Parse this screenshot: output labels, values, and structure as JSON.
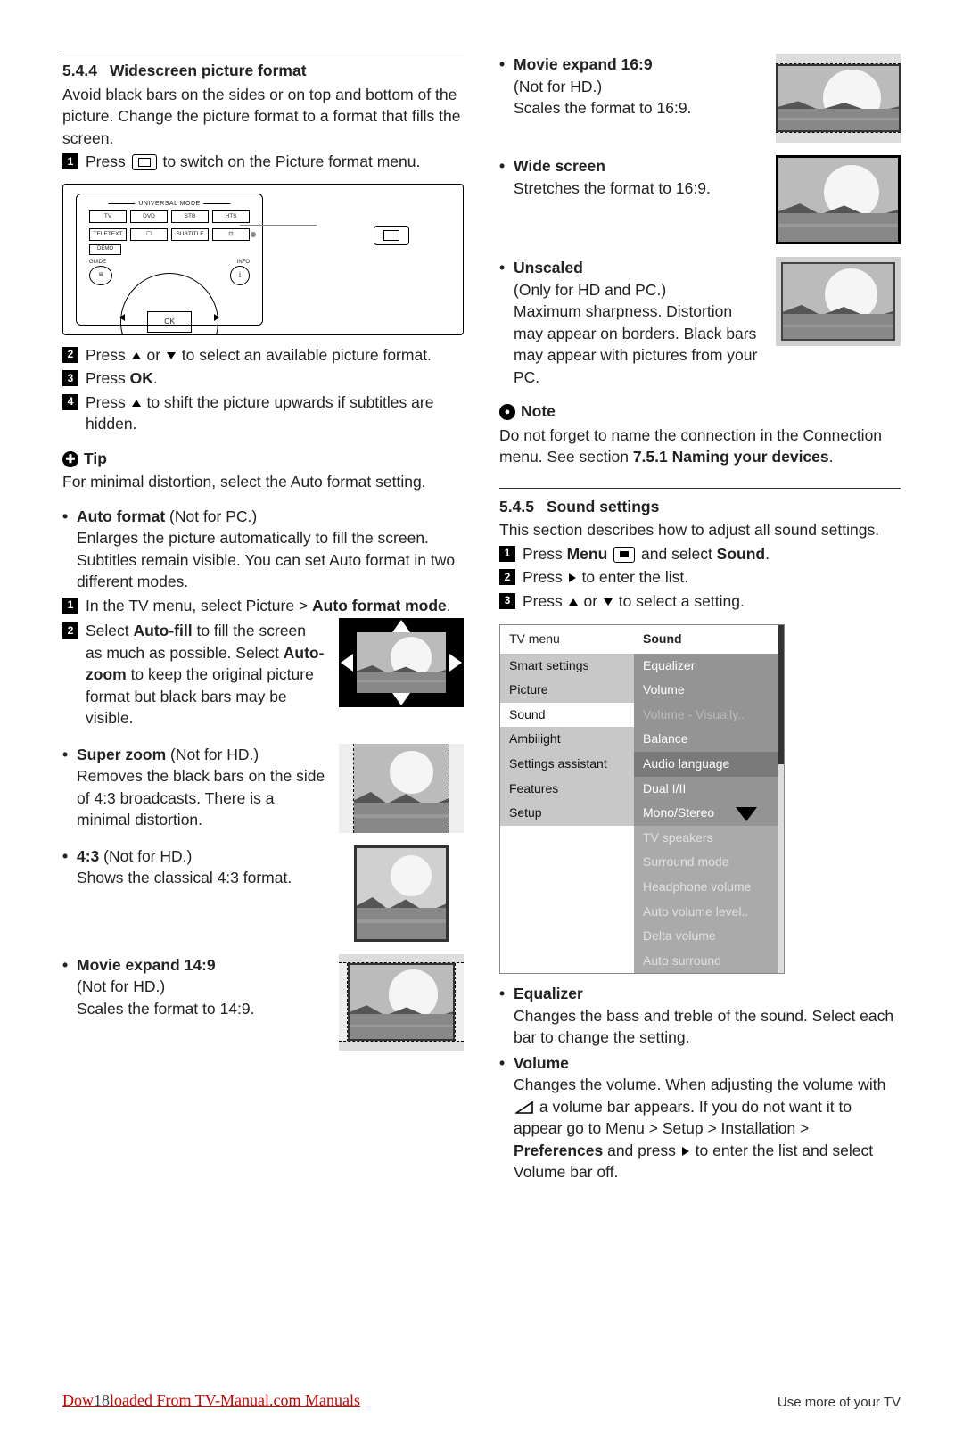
{
  "left": {
    "sec544": {
      "num": "5.4.4",
      "title": "Widescreen picture format",
      "intro": "Avoid black bars on the sides or on top and bottom of the picture. Change the picture format to a format that fills the screen.",
      "step1a": "Press ",
      "step1b": " to switch on the Picture format menu.",
      "step2": "Press ",
      "step2b": " or ",
      "step2c": " to select an available picture format.",
      "step3a": "Press ",
      "step3b": "OK",
      "step3c": ".",
      "step4": "Press ",
      "step4b": " to shift the picture upwards if subtitles are hidden."
    },
    "remote": {
      "mode": "UNIVERSAL MODE",
      "tv": "TV",
      "dvd": "DVD",
      "stb": "STB",
      "hts": "HTS",
      "teletext": "TELETEXT",
      "subtitle": "SUBTITLE",
      "demo": "DEMO",
      "guide": "GUIDE",
      "info": "INFO",
      "ok": "OK"
    },
    "tip": {
      "label": "Tip",
      "text": "For minimal distortion, select the Auto format setting."
    },
    "autoformat": {
      "head": "Auto format",
      "note": " (Not for PC.)",
      "body": "Enlarges the picture automatically to fill the screen. Subtitles remain visible. You can set Auto format in two different modes.",
      "s1a": "In the TV menu, select Picture > ",
      "s1b": "Auto format mode",
      "s1c": ".",
      "s2a": "Select ",
      "s2b": "Auto-fill",
      "s2c": " to fill the screen as much as possible. Select ",
      "s2d": "Auto-zoom",
      "s2e": " to keep the original picture format but black bars may be visible."
    },
    "superzoom": {
      "head": "Super zoom",
      "note": " (Not for HD.)",
      "body": "Removes the black bars on the side of 4:3 broadcasts. There is a minimal distortion."
    },
    "f43": {
      "head": "4:3",
      "note": " (Not for HD.)",
      "body": "Shows the classical 4:3 format."
    },
    "m149": {
      "head": "Movie expand 14:9",
      "note": "(Not for HD.)",
      "body": "Scales the format to 14:9."
    }
  },
  "right": {
    "m169": {
      "head": "Movie expand 16:9",
      "note": "(Not for HD.)",
      "body": "Scales the format to 16:9."
    },
    "wide": {
      "head": "Wide screen",
      "body": "Stretches the format to 16:9."
    },
    "unscaled": {
      "head": "Unscaled",
      "note": "(Only for HD and PC.)",
      "body": "Maximum sharpness. Distortion may appear on borders. Black bars may appear with pictures from your PC."
    },
    "note": {
      "label": "Note",
      "a": "Do not forget to name the connection in the Connection menu. See section ",
      "b": "7.5.1 Naming your devices",
      "c": "."
    },
    "sec545": {
      "num": "5.4.5",
      "title": "Sound settings",
      "intro": "This section describes how to adjust all sound settings.",
      "s1a": "Press ",
      "s1b": "Menu ",
      "s1c": " and select ",
      "s1d": "Sound",
      "s1e": ".",
      "s2a": "Press ",
      "s2b": " to enter the list.",
      "s3a": "Press ",
      "s3b": " or ",
      "s3c": " to select a setting."
    },
    "menu": {
      "h1": "TV menu",
      "h2": "Sound",
      "c1": [
        "Smart settings",
        "Picture",
        "Sound",
        "Ambilight",
        "Settings assistant",
        "Features",
        "Setup"
      ],
      "c2": [
        "Equalizer",
        "Volume",
        "Volume - Visually..",
        "Balance",
        "Audio language",
        "Dual I/II",
        "Mono/Stereo",
        "TV speakers",
        "Surround mode",
        "Headphone volume",
        "Auto volume level..",
        "Delta volume",
        "Auto surround"
      ]
    },
    "eq": {
      "head": "Equalizer",
      "body": "Changes the bass and treble of the sound. Select each bar to change the setting."
    },
    "vol": {
      "head": "Volume",
      "a": "Changes the volume. When adjusting the volume with ",
      "b": " a volume bar appears. If you do not want it to appear go to Menu > Setup > Installation > ",
      "c": "Preferences",
      "d": " and press ",
      "e": " to enter the list and select Volume bar off."
    }
  },
  "footer": {
    "left": "Downloaded From TV-Manual.com Manuals",
    "pagenum": "18",
    "right": "Use more of your TV"
  }
}
